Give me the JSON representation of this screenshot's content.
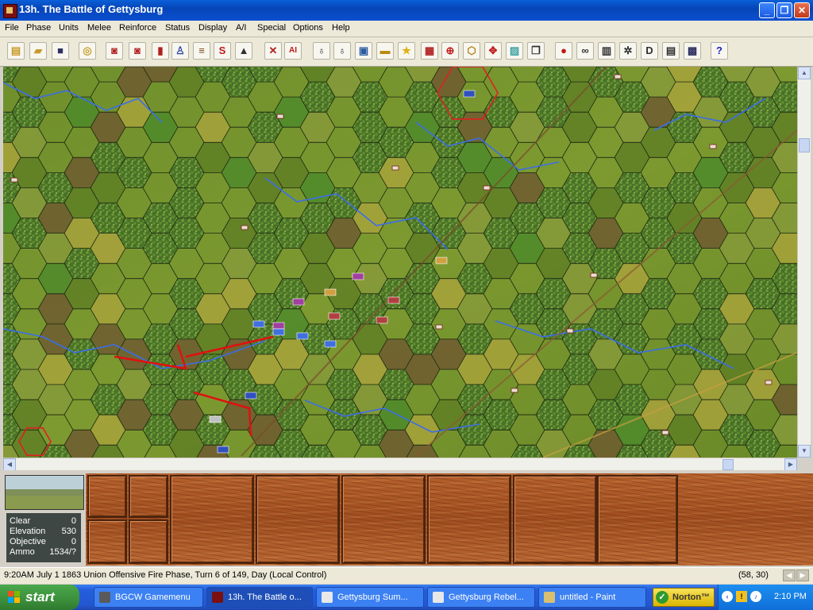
{
  "window": {
    "title": "13h. The Battle of Gettysburg",
    "icon": "cannon-app-icon",
    "controls": [
      "minimize",
      "restore",
      "close"
    ]
  },
  "menu": [
    "File",
    "Phase",
    "Units",
    "Melee",
    "Reinforce",
    "Status",
    "Display",
    "A/I",
    "Special",
    "Options",
    "Help"
  ],
  "toolbar": {
    "buttons": [
      {
        "name": "new-icon",
        "glyph": "▤",
        "color": "#c99a2a"
      },
      {
        "name": "open-icon",
        "glyph": "▰",
        "color": "#c79b2e"
      },
      {
        "name": "save-icon",
        "glyph": "■",
        "color": "#303060"
      },
      {
        "name": "replay-icon",
        "glyph": "◎",
        "color": "#caa030"
      },
      {
        "name": "fire-icon",
        "glyph": "◙",
        "color": "#b02020"
      },
      {
        "name": "melee-icon",
        "glyph": "◙",
        "color": "#b02020"
      },
      {
        "name": "stack-icon",
        "glyph": "▮",
        "color": "#b02020"
      },
      {
        "name": "infantry-icon",
        "glyph": "♙",
        "color": "#2d4aa0"
      },
      {
        "name": "artillery-icon",
        "glyph": "≡",
        "color": "#7a4a20"
      },
      {
        "name": "supply-icon",
        "glyph": "S",
        "color": "#c01818"
      },
      {
        "name": "pyramid-icon",
        "glyph": "▲",
        "color": "#303030"
      },
      {
        "name": "cannon-icon",
        "glyph": "✕",
        "color": "#b02020"
      },
      {
        "name": "ai-icon",
        "glyph": "AI",
        "color": "#c01818"
      },
      {
        "name": "hex-up-icon",
        "glyph": "♁",
        "color": "#303030"
      },
      {
        "name": "hex-down-icon",
        "glyph": "♁",
        "color": "#303030"
      },
      {
        "name": "map-icon",
        "glyph": "▣",
        "color": "#2a5aa0"
      },
      {
        "name": "leader-icon",
        "glyph": "▬",
        "color": "#b88a10"
      },
      {
        "name": "star-icon",
        "glyph": "★",
        "color": "#e0b010"
      },
      {
        "name": "flag-icon",
        "glyph": "▦",
        "color": "#b02020"
      },
      {
        "name": "target-icon",
        "glyph": "⊕",
        "color": "#c02020"
      },
      {
        "name": "hex-outline-icon",
        "glyph": "⬡",
        "color": "#b08010"
      },
      {
        "name": "move-icon",
        "glyph": "✥",
        "color": "#c02020"
      },
      {
        "name": "highlight-icon",
        "glyph": "▨",
        "color": "#3aa0a0"
      },
      {
        "name": "windows-icon",
        "glyph": "❐",
        "color": "#303030"
      },
      {
        "name": "toggle-1-icon",
        "glyph": "●",
        "color": "#c01818"
      },
      {
        "name": "toggle-2-icon",
        "glyph": "∞",
        "color": "#303030"
      },
      {
        "name": "toggle-3-icon",
        "glyph": "▥",
        "color": "#303030"
      },
      {
        "name": "toggle-4-icon",
        "glyph": "✲",
        "color": "#303030"
      },
      {
        "name": "toggle-d-icon",
        "glyph": "D",
        "color": "#303030"
      },
      {
        "name": "toggle-6-icon",
        "glyph": "▤",
        "color": "#303030"
      },
      {
        "name": "toggle-7-icon",
        "glyph": "▩",
        "color": "#303060"
      },
      {
        "name": "help-icon",
        "glyph": "?",
        "color": "#2020c0"
      }
    ]
  },
  "terrain_info": {
    "rows": [
      {
        "label": "Clear",
        "value": "0"
      },
      {
        "label": "Elevation",
        "value": "530"
      },
      {
        "label": "Objective",
        "value": "0"
      },
      {
        "label": "Ammo",
        "value": "1534/?"
      }
    ]
  },
  "status": {
    "text": "9:20AM July 1 1863 Union Offensive Fire Phase, Turn 6 of 149, Day (Local Control)",
    "coords": "(58, 30)"
  },
  "taskbar": {
    "start_label": "start",
    "tasks": [
      {
        "label": "BGCW Gamemenu",
        "icon": "gamemenu-icon",
        "color": "#5a5a5a",
        "active": false
      },
      {
        "label": "13h. The Battle o...",
        "icon": "cannon-app-icon",
        "color": "#7a1010",
        "active": true
      },
      {
        "label": "Gettysburg Sum...",
        "icon": "document-icon",
        "color": "#e8e8e8",
        "active": false
      },
      {
        "label": "Gettysburg Rebel...",
        "icon": "document-icon",
        "color": "#e8e8e8",
        "active": false
      },
      {
        "label": "untitled - Paint",
        "icon": "paint-icon",
        "color": "#d8c070",
        "active": false
      }
    ],
    "norton_label": "Norton™",
    "clock": "2:10 PM"
  }
}
